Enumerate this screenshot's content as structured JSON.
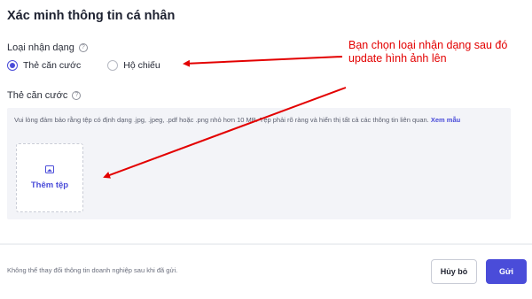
{
  "page": {
    "title": "Xác minh thông tin cá nhân"
  },
  "id_type": {
    "label": "Loại nhận dạng",
    "options": [
      {
        "label": "Thẻ căn cước",
        "selected": true
      },
      {
        "label": "Hộ chiếu",
        "selected": false
      }
    ]
  },
  "id_card": {
    "label": "Thẻ căn cước",
    "hint": "Vui lòng đảm bảo rằng tệp có định dạng .jpg, .jpeg, .pdf hoặc .png nhỏ hơn 10 MB. Tệp phải rõ ràng và hiển thị tất cả các thông tin liên quan.",
    "hint_link": "Xem mẫu",
    "add_file_label": "Thêm tệp"
  },
  "footer": {
    "note": "Không thể thay đổi thông tin doanh nghiệp sau khi đã gửi.",
    "cancel_label": "Hủy bỏ",
    "submit_label": "Gửi"
  },
  "annotation": {
    "text": "Bạn chọn loại nhận dạng sau đó update hình ảnh lên",
    "color": "#e30000"
  },
  "colors": {
    "accent": "#4a4cd9",
    "background": "#eef0f3"
  },
  "icons": [
    "help-icon",
    "image-icon"
  ]
}
